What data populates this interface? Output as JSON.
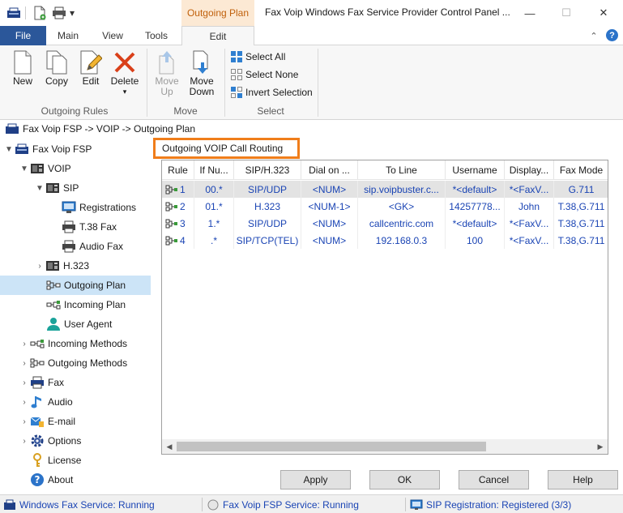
{
  "window": {
    "title": "Fax Voip Windows Fax Service Provider Control Panel ...",
    "context_tab": "Outgoing Plan",
    "qa_dropdown": "▾",
    "minimize": "—",
    "maximize": "☐",
    "close": "✕",
    "collapse_ribbon": "⌃",
    "help": "?"
  },
  "ribbon": {
    "tabs": [
      "File",
      "Main",
      "View",
      "Tools",
      "Edit"
    ],
    "groups": {
      "outgoing_rules": "Outgoing Rules",
      "move": "Move",
      "select": "Select"
    },
    "buttons": {
      "new": "New",
      "copy": "Copy",
      "edit": "Edit",
      "delete": "Delete",
      "delete_arrow": "▾",
      "move_up_1": "Move",
      "move_up_2": "Up",
      "move_down_1": "Move",
      "move_down_2": "Down",
      "select_all": "Select All",
      "select_none": "Select None",
      "invert_selection": "Invert Selection"
    }
  },
  "breadcrumb": "Fax Voip FSP -> VOIP -> Outgoing Plan",
  "tree": {
    "items": [
      {
        "label": "Fax Voip FSP"
      },
      {
        "label": "VOIP"
      },
      {
        "label": "SIP"
      },
      {
        "label": "Registrations"
      },
      {
        "label": "T.38 Fax"
      },
      {
        "label": "Audio Fax"
      },
      {
        "label": "H.323"
      },
      {
        "label": "Outgoing Plan"
      },
      {
        "label": "Incoming Plan"
      },
      {
        "label": "User Agent"
      },
      {
        "label": "Incoming Methods"
      },
      {
        "label": "Outgoing Methods"
      },
      {
        "label": "Fax"
      },
      {
        "label": "Audio"
      },
      {
        "label": "E-mail"
      },
      {
        "label": "Options"
      },
      {
        "label": "License"
      },
      {
        "label": "About"
      }
    ]
  },
  "panel": {
    "title": "Outgoing VOIP Call Routing",
    "columns": [
      "Rule",
      "If Nu...",
      "SIP/H.323",
      "Dial on ...",
      "To Line",
      "Username",
      "Display...",
      "Fax Mode"
    ],
    "rows": [
      [
        "1",
        "00.*",
        "SIP/UDP",
        "<NUM>",
        "sip.voipbuster.c...",
        "*<default>",
        "*<FaxV...",
        "G.711"
      ],
      [
        "2",
        "01.*",
        "H.323",
        "<NUM-1>",
        "<GK>",
        "14257778...",
        "John",
        "T.38,G.711"
      ],
      [
        "3",
        "1.*",
        "SIP/UDP",
        "<NUM>",
        "callcentric.com",
        "*<default>",
        "*<FaxV...",
        "T.38,G.711"
      ],
      [
        "4",
        ".*",
        "SIP/TCP(TEL)",
        "<NUM>",
        "192.168.0.3",
        "100",
        "*<FaxV...",
        "T.38,G.711"
      ]
    ],
    "scroll_left": "◀",
    "scroll_right": "▶"
  },
  "dialog": {
    "apply": "Apply",
    "ok": "OK",
    "cancel": "Cancel",
    "help": "Help"
  },
  "status": {
    "windows_fax": "Windows Fax Service: Running",
    "fsp": "Fax Voip FSP Service: Running",
    "sip": "SIP Registration: Registered (3/3)"
  },
  "colors": {
    "accent": "#2b579a",
    "context_tab_bg": "#fce9d4",
    "context_tab_text": "#c0600b",
    "highlight_border": "#f07d1a",
    "link_text": "#1a44b4",
    "selection": "#cce4f7"
  }
}
